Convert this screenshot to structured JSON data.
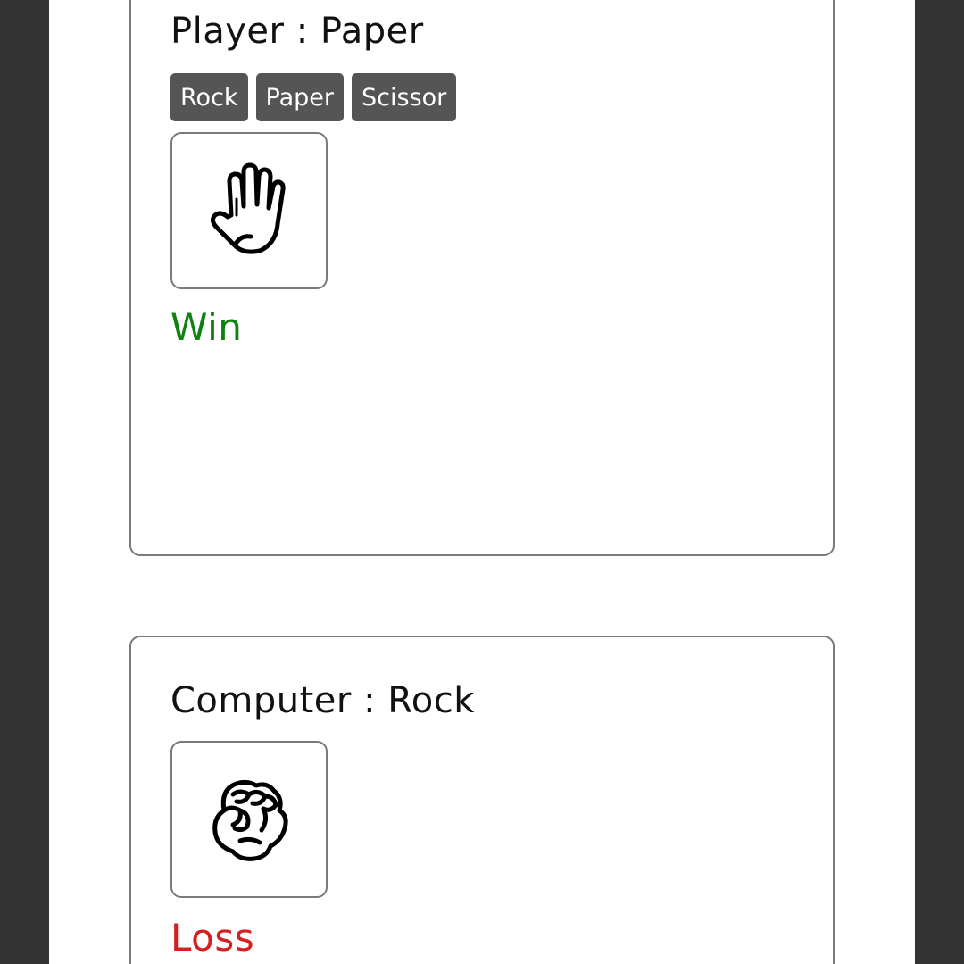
{
  "player": {
    "title": "Player : Paper",
    "choices": [
      "Rock",
      "Paper",
      "Scissor"
    ],
    "hand_icon": "paper-hand-icon",
    "result": "Win",
    "result_color": "#108010"
  },
  "computer": {
    "title": "Computer : Rock",
    "hand_icon": "rock-fist-icon",
    "result": "Loss",
    "result_color": "#d42020"
  },
  "colors": {
    "background": "#333333",
    "page": "#ffffff",
    "button": "#555555",
    "border": "#7a7a7a"
  }
}
